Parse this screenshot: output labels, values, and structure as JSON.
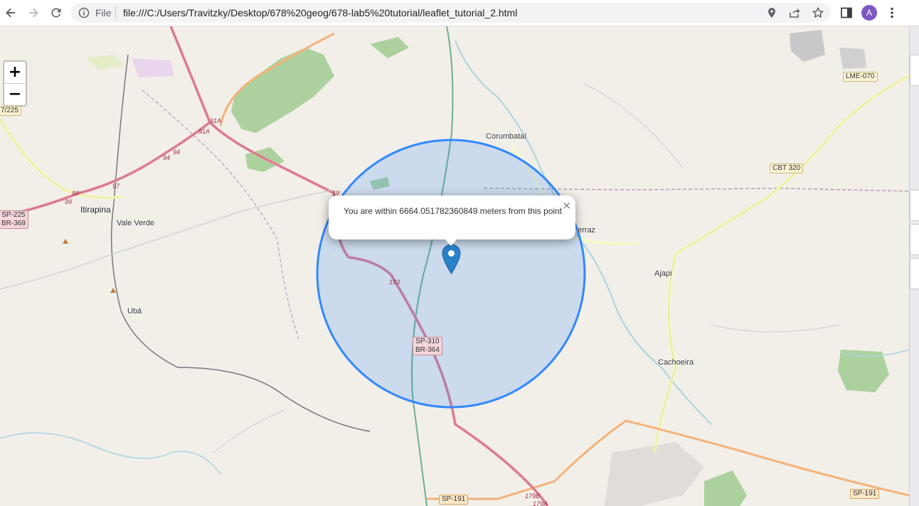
{
  "browser": {
    "back_icon": "arrow-left-icon",
    "forward_icon": "arrow-right-icon",
    "reload_icon": "reload-icon",
    "scheme_label": "File",
    "url": "file:///C:/Users/Travitzky/Desktop/678%20geog/678-lab5%20tutorial/leaflet_tutorial_2.html",
    "avatar_letter": "A",
    "accent_color": "#7e57c2"
  },
  "map": {
    "zoom_in": "+",
    "zoom_out": "−",
    "popup": {
      "text": "You are within 6664.051782360849 meters from this point",
      "close": "×"
    },
    "circle_color": "#3388ff",
    "marker_color": "#2a81cb",
    "places": {
      "itirapina": "Itirapina",
      "vale_verde": "Vale Verde",
      "uba": "Ubá",
      "corumbatai": "Corumbataí",
      "ferraz": "errаz",
      "ajapi": "Ajapi",
      "cachoeira": "Cachoeira"
    },
    "shields": {
      "sp225_line1": "SP-225",
      "sp225_line2": "BR-369",
      "sp310_line1": "SP-310",
      "sp310_line2": "BR-364",
      "lme070": "LME-070",
      "cbt320": "CBT 320",
      "sp191_left": "SP-191",
      "sp191_right": "SP-191",
      "left_edge": "7/225"
    },
    "route_numbers": {
      "r91a_1": "91A",
      "r91a_2": "91A",
      "r94_1": "94",
      "r94_2": "94",
      "r97": "97",
      "r99_1": "99",
      "r99_2": "99",
      "r193": "193",
      "r19": "19",
      "r179b": "179B",
      "r179a": "179A"
    }
  }
}
